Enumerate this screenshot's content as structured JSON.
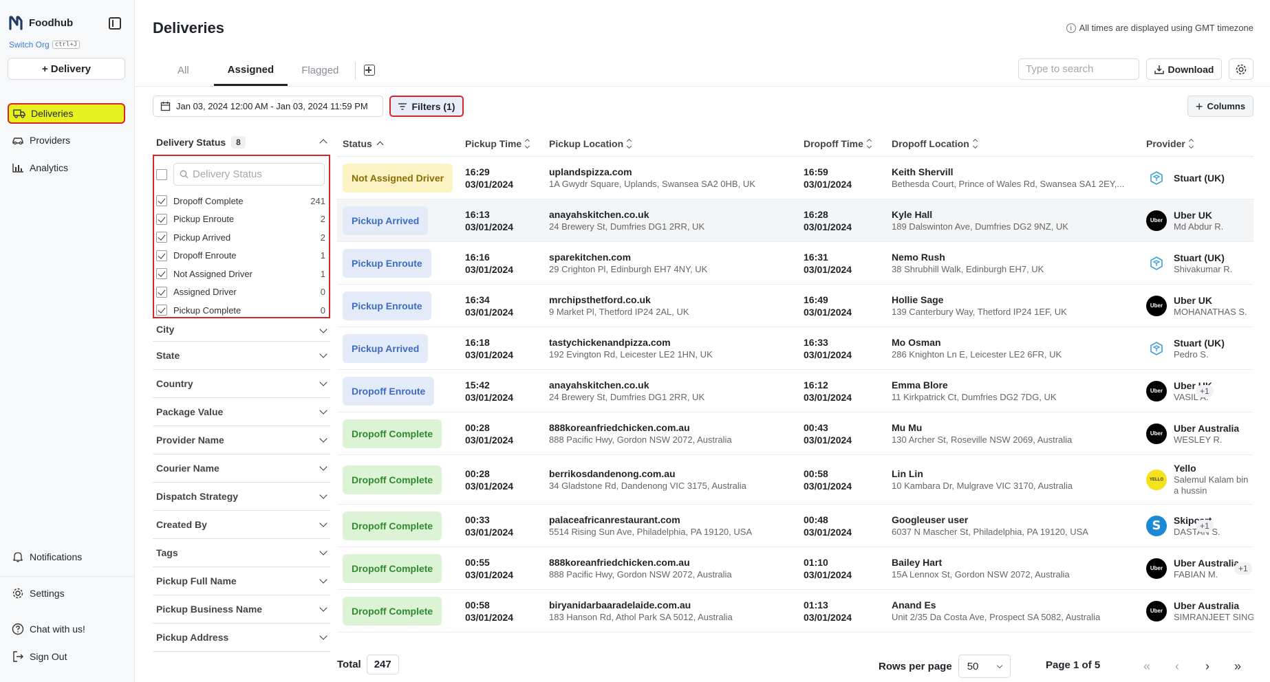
{
  "app": {
    "brand": "Foodhub",
    "switch_org": "Switch Org",
    "switch_org_shortcut": "ctrl+J",
    "add_delivery": "+ Delivery"
  },
  "nav": {
    "deliveries": "Deliveries",
    "providers": "Providers",
    "analytics": "Analytics",
    "notifications": "Notifications",
    "settings": "Settings",
    "chat": "Chat with us!",
    "sign_out": "Sign Out"
  },
  "header": {
    "title": "Deliveries",
    "timezone_note": "All times are displayed using GMT timezone",
    "tabs": [
      "All",
      "Assigned",
      "Flagged"
    ],
    "active_tab": "Assigned",
    "search_placeholder": "Type to search",
    "download": "Download"
  },
  "toolbar": {
    "date_range": "Jan 03, 2024 12:00 AM - Jan 03, 2024 11:59 PM",
    "filters": "Filters (1)",
    "columns": "Columns"
  },
  "filters": {
    "status_title": "Delivery Status",
    "status_count": "8",
    "status_search_placeholder": "Delivery Status",
    "status_options": [
      {
        "label": "Dropoff Complete",
        "count": "241",
        "checked": true
      },
      {
        "label": "Pickup Enroute",
        "count": "2",
        "checked": true
      },
      {
        "label": "Pickup Arrived",
        "count": "2",
        "checked": true
      },
      {
        "label": "Dropoff Enroute",
        "count": "1",
        "checked": true
      },
      {
        "label": "Not Assigned Driver",
        "count": "1",
        "checked": true
      },
      {
        "label": "Assigned Driver",
        "count": "0",
        "checked": true
      },
      {
        "label": "Pickup Complete",
        "count": "0",
        "checked": true
      }
    ],
    "sections": [
      "City",
      "State",
      "Country",
      "Package Value",
      "Provider Name",
      "Courier Name",
      "Dispatch Strategy",
      "Created By",
      "Tags",
      "Pickup Full Name",
      "Pickup Business Name",
      "Pickup Address"
    ]
  },
  "table": {
    "columns": [
      "Status",
      "Pickup Time",
      "Pickup Location",
      "Dropoff Time",
      "Dropoff Location",
      "Provider"
    ],
    "rows": [
      {
        "status": "Not Assigned Driver",
        "tone": "yellow",
        "ptime": "16:29",
        "pdate": "03/01/2024",
        "pname": "uplandspizza.com",
        "paddr": "1A Gwydr Square, Uplands, Swansea SA2 0HB, UK",
        "dtime": "16:59",
        "ddate": "03/01/2024",
        "dname": "Keith Shervill",
        "daddr": "Bethesda Court, Prince of Wales Rd, Swansea SA1 2EY,...",
        "provider": "Stuart (UK)",
        "courier": "",
        "logo": "stuart",
        "extra": ""
      },
      {
        "status": "Pickup Arrived",
        "tone": "blue",
        "ptime": "16:13",
        "pdate": "03/01/2024",
        "pname": "anayahskitchen.co.uk",
        "paddr": "24 Brewery St, Dumfries DG1 2RR, UK",
        "dtime": "16:28",
        "ddate": "03/01/2024",
        "dname": "Kyle Hall",
        "daddr": "189 Dalswinton Ave, Dumfries DG2 9NZ, UK",
        "provider": "Uber UK",
        "courier": "Md Abdur R.",
        "logo": "uber",
        "extra": ""
      },
      {
        "status": "Pickup Enroute",
        "tone": "blue",
        "ptime": "16:16",
        "pdate": "03/01/2024",
        "pname": "sparekitchen.com",
        "paddr": "29 Crighton Pl, Edinburgh EH7 4NY, UK",
        "dtime": "16:31",
        "ddate": "03/01/2024",
        "dname": "Nemo Rush",
        "daddr": "38 Shrubhill Walk, Edinburgh EH7, UK",
        "provider": "Stuart (UK)",
        "courier": "Shivakumar R.",
        "logo": "stuart",
        "extra": ""
      },
      {
        "status": "Pickup Enroute",
        "tone": "blue",
        "ptime": "16:34",
        "pdate": "03/01/2024",
        "pname": "mrchipsthetford.co.uk",
        "paddr": "9 Market Pl, Thetford IP24 2AL, UK",
        "dtime": "16:49",
        "ddate": "03/01/2024",
        "dname": "Hollie Sage",
        "daddr": "139 Canterbury Way, Thetford IP24 1EF, UK",
        "provider": "Uber UK",
        "courier": "MOHANATHAS S.",
        "logo": "uber",
        "extra": ""
      },
      {
        "status": "Pickup Arrived",
        "tone": "blue",
        "ptime": "16:18",
        "pdate": "03/01/2024",
        "pname": "tastychickenandpizza.com",
        "paddr": "192 Evington Rd, Leicester LE2 1HN, UK",
        "dtime": "16:33",
        "ddate": "03/01/2024",
        "dname": "Mo Osman",
        "daddr": "286 Knighton Ln E, Leicester LE2 6FR, UK",
        "provider": "Stuart (UK)",
        "courier": "Pedro S.",
        "logo": "stuart",
        "extra": ""
      },
      {
        "status": "Dropoff Enroute",
        "tone": "blue",
        "ptime": "15:42",
        "pdate": "03/01/2024",
        "pname": "anayahskitchen.co.uk",
        "paddr": "24 Brewery St, Dumfries DG1 2RR, UK",
        "dtime": "16:12",
        "ddate": "03/01/2024",
        "dname": "Emma Blore",
        "daddr": "11 Kirkpatrick Ct, Dumfries DG2 7DG, UK",
        "provider": "Uber UK",
        "courier": "VASIL A.",
        "logo": "uber",
        "extra": "+1"
      },
      {
        "status": "Dropoff Complete",
        "tone": "green",
        "ptime": "00:28",
        "pdate": "03/01/2024",
        "pname": "888koreanfriedchicken.com.au",
        "paddr": "888 Pacific Hwy, Gordon NSW 2072, Australia",
        "dtime": "00:43",
        "ddate": "03/01/2024",
        "dname": "Mu Mu",
        "daddr": "130 Archer St, Roseville NSW 2069, Australia",
        "provider": "Uber Australia",
        "courier": "WESLEY R.",
        "logo": "uber",
        "extra": ""
      },
      {
        "status": "Dropoff Complete",
        "tone": "green",
        "ptime": "00:28",
        "pdate": "03/01/2024",
        "pname": "berrikosdandenong.com.au",
        "paddr": "34 Gladstone Rd, Dandenong VIC 3175, Australia",
        "dtime": "00:58",
        "ddate": "03/01/2024",
        "dname": "Lin Lin",
        "daddr": "10 Kambara Dr, Mulgrave VIC 3170, Australia",
        "provider": "Yello",
        "courier": "Salemul Kalam bin a hussin",
        "logo": "yello",
        "extra": ""
      },
      {
        "status": "Dropoff Complete",
        "tone": "green",
        "ptime": "00:33",
        "pdate": "03/01/2024",
        "pname": "palaceafricanrestaurant.com",
        "paddr": "5514 Rising Sun Ave, Philadelphia, PA 19120, USA",
        "dtime": "00:48",
        "ddate": "03/01/2024",
        "dname": "Googleuser user",
        "daddr": "6037 N Mascher St, Philadelphia, PA 19120, USA",
        "provider": "Skipcart",
        "courier": "DASTAN S.",
        "logo": "skip",
        "extra": "+1"
      },
      {
        "status": "Dropoff Complete",
        "tone": "green",
        "ptime": "00:55",
        "pdate": "03/01/2024",
        "pname": "888koreanfriedchicken.com.au",
        "paddr": "888 Pacific Hwy, Gordon NSW 2072, Australia",
        "dtime": "01:10",
        "ddate": "03/01/2024",
        "dname": "Bailey Hart",
        "daddr": "15A Lennox St, Gordon NSW 2072, Australia",
        "provider": "Uber Australia",
        "courier": "FABIAN M.",
        "logo": "uber",
        "extra": "+1"
      },
      {
        "status": "Dropoff Complete",
        "tone": "green",
        "ptime": "00:58",
        "pdate": "03/01/2024",
        "pname": "biryanidarbaaradelaide.com.au",
        "paddr": "183 Hanson Rd, Athol Park SA 5012, Australia",
        "dtime": "01:13",
        "ddate": "03/01/2024",
        "dname": "Anand Es",
        "daddr": "Unit 2/35 Da Costa Ave, Prospect SA 5082, Australia",
        "provider": "Uber Australia",
        "courier": "SIMRANJEET SINGH",
        "logo": "uber",
        "extra": ""
      }
    ]
  },
  "footer": {
    "total_label": "Total",
    "total": "247",
    "rows_per_page_label": "Rows per page",
    "rows_per_page": "50",
    "page_label": "Page 1 of 5"
  },
  "colors": {
    "active_nav": "#e6f11e",
    "highlight_border": "#d8232a",
    "pill_green": "#dcf3d6",
    "pill_blue": "#e3ebf9",
    "pill_yellow": "#fbf3c4"
  }
}
